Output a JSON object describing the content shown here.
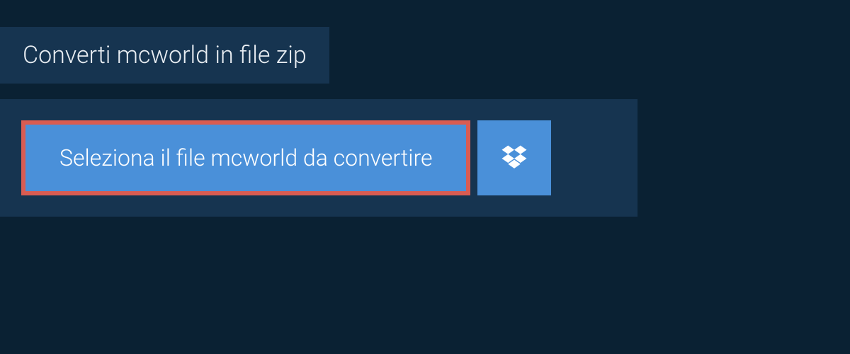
{
  "header": {
    "title": "Converti mcworld in file zip"
  },
  "actions": {
    "select_file_label": "Seleziona il file mcworld da convertire"
  },
  "colors": {
    "background_dark": "#0a2133",
    "panel": "#163450",
    "button_primary": "#4a90d9",
    "highlight_border": "#d95c52"
  }
}
